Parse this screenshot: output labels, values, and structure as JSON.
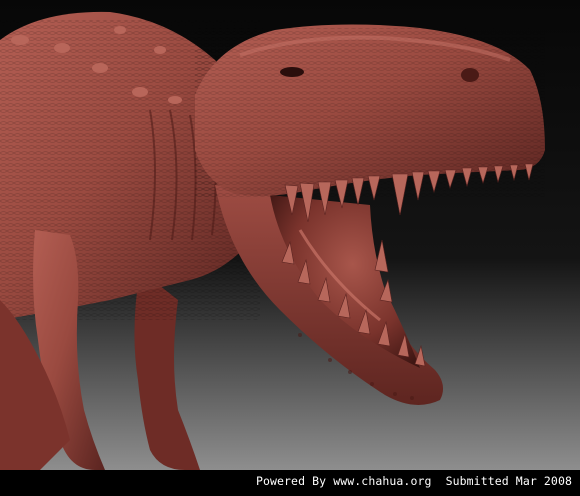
{
  "image": {
    "subject": "",
    "skin_color": "#9a4a40",
    "shadow_color": "#3a1412",
    "highlight_color": "#c76e62",
    "background_top": "#0a0a0a",
    "background_bottom": "#8a8a8a"
  },
  "caption": {
    "text": "Powered By www.chahua.org  Submitted Mar 2008"
  }
}
